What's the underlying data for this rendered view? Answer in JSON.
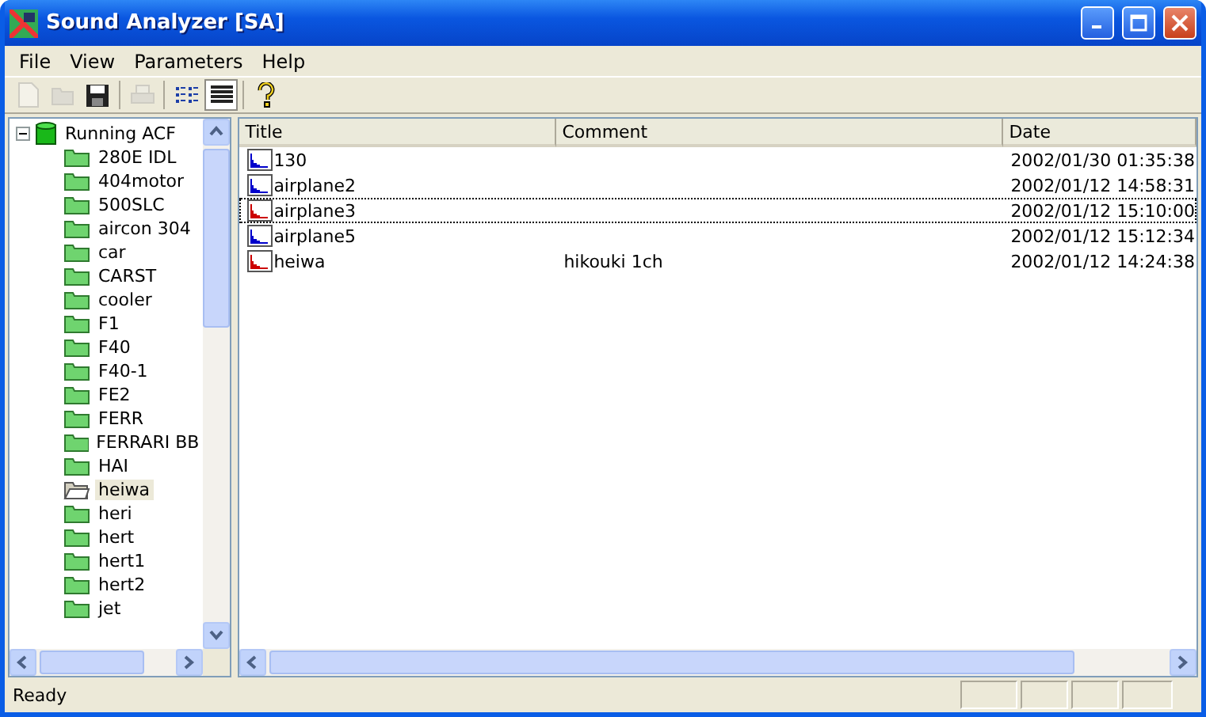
{
  "window": {
    "title": "Sound Analyzer [SA]"
  },
  "menu": [
    "File",
    "View",
    "Parameters",
    "Help"
  ],
  "toolbar": [
    {
      "kind": "new",
      "disabled": true,
      "pressed": false
    },
    {
      "kind": "open",
      "disabled": true,
      "pressed": false
    },
    {
      "kind": "save",
      "disabled": false,
      "pressed": false
    },
    {
      "kind": "print",
      "disabled": true,
      "pressed": false
    },
    {
      "kind": "list",
      "disabled": false,
      "pressed": false
    },
    {
      "kind": "details",
      "disabled": false,
      "pressed": true
    },
    {
      "kind": "help",
      "disabled": false,
      "pressed": false
    }
  ],
  "tree": {
    "label": "Running ACF",
    "expanded": true,
    "children": [
      {
        "label": "280E IDL",
        "selected": false
      },
      {
        "label": "404motor",
        "selected": false
      },
      {
        "label": "500SLC",
        "selected": false
      },
      {
        "label": "aircon 304",
        "selected": false
      },
      {
        "label": "car",
        "selected": false
      },
      {
        "label": "CARST",
        "selected": false
      },
      {
        "label": "cooler",
        "selected": false
      },
      {
        "label": "F1",
        "selected": false
      },
      {
        "label": "F40",
        "selected": false
      },
      {
        "label": "F40-1",
        "selected": false
      },
      {
        "label": "FE2",
        "selected": false
      },
      {
        "label": "FERR",
        "selected": false
      },
      {
        "label": "FERRARI BB",
        "selected": false
      },
      {
        "label": "HAI",
        "selected": false
      },
      {
        "label": "heiwa",
        "selected": true
      },
      {
        "label": "heri",
        "selected": false
      },
      {
        "label": "hert",
        "selected": false
      },
      {
        "label": "hert1",
        "selected": false
      },
      {
        "label": "hert2",
        "selected": false
      },
      {
        "label": "jet",
        "selected": false
      }
    ]
  },
  "table": {
    "columns": [
      "Title",
      "Comment",
      "Date"
    ],
    "rows": [
      {
        "title": "130",
        "comment": "",
        "date": "2002/01/30 01:35:38",
        "color": "#0000cc",
        "focused": false
      },
      {
        "title": "airplane2",
        "comment": "",
        "date": "2002/01/12 14:58:31",
        "color": "#0000cc",
        "focused": false
      },
      {
        "title": "airplane3",
        "comment": "",
        "date": "2002/01/12 15:10:00",
        "color": "#cc0000",
        "focused": true
      },
      {
        "title": "airplane5",
        "comment": "",
        "date": "2002/01/12 15:12:34",
        "color": "#0000cc",
        "focused": false
      },
      {
        "title": "heiwa",
        "comment": "hikouki 1ch",
        "date": "2002/01/12 14:24:38",
        "color": "#cc0000",
        "focused": false
      }
    ]
  },
  "status_bar": {
    "text": "Ready"
  }
}
